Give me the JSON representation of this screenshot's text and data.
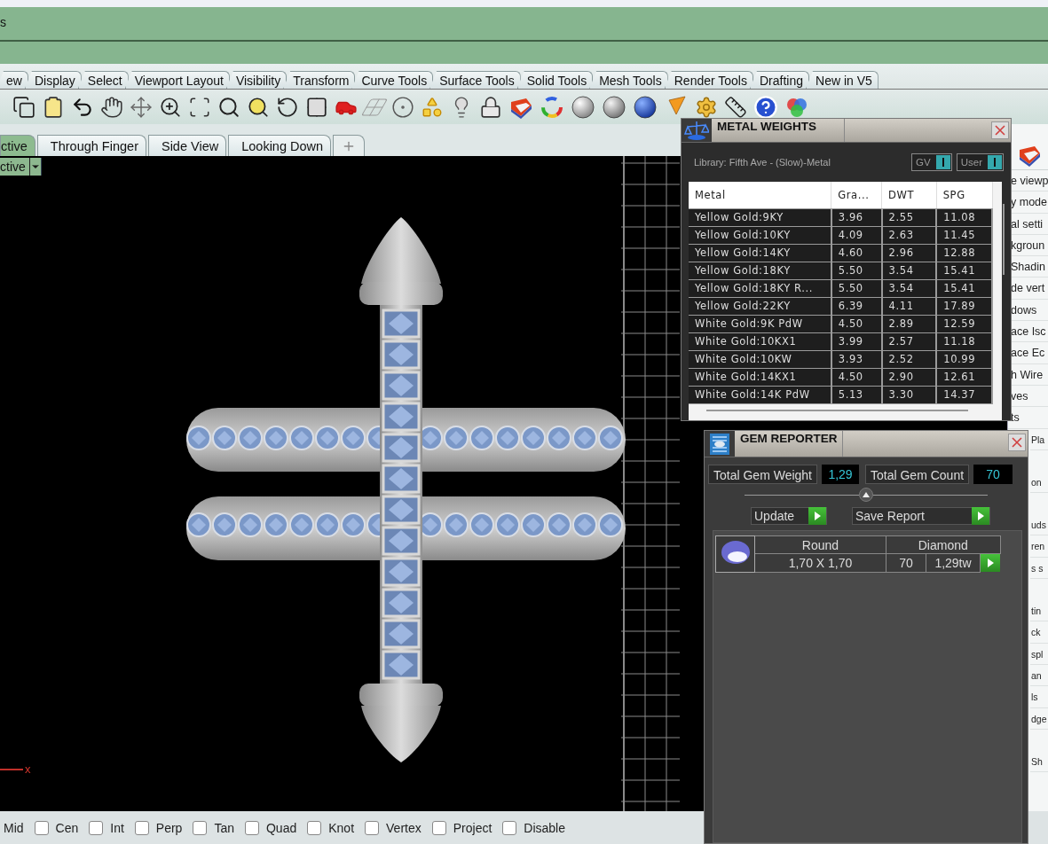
{
  "window": {
    "title": "s"
  },
  "toolbar_tabs": [
    {
      "label": "ew",
      "selected": false
    },
    {
      "label": "Display",
      "selected": false
    },
    {
      "label": "Select",
      "selected": false
    },
    {
      "label": "Viewport Layout",
      "selected": false
    },
    {
      "label": "Visibility",
      "selected": false
    },
    {
      "label": "Transform",
      "selected": false
    },
    {
      "label": "Curve Tools",
      "selected": false
    },
    {
      "label": "Surface Tools",
      "selected": false
    },
    {
      "label": "Solid Tools",
      "selected": false
    },
    {
      "label": "Mesh Tools",
      "selected": false
    },
    {
      "label": "Render Tools",
      "selected": false
    },
    {
      "label": "Drafting",
      "selected": false
    },
    {
      "label": "New in V5",
      "selected": false
    }
  ],
  "viewport_tabs": [
    {
      "label": "ctive",
      "selected": true
    },
    {
      "label": "Through Finger",
      "selected": false
    },
    {
      "label": "Side View",
      "selected": false
    },
    {
      "label": "Looking Down",
      "selected": false
    }
  ],
  "viewport": {
    "label": "ctive",
    "axis_label": "x"
  },
  "metal_weights": {
    "title": "METAL WEIGHTS",
    "library": "Library: Fifth Ave - (Slow)-Metal",
    "toggles": [
      {
        "label": "GV",
        "on": true
      },
      {
        "label": "User",
        "on": true
      }
    ],
    "columns": [
      "Metal",
      "Gra...",
      "DWT",
      "SPG"
    ],
    "rows": [
      [
        "Yellow Gold:9KY",
        "3.96",
        "2.55",
        "11.08"
      ],
      [
        "Yellow Gold:10KY",
        "4.09",
        "2.63",
        "11.45"
      ],
      [
        "Yellow Gold:14KY",
        "4.60",
        "2.96",
        "12.88"
      ],
      [
        "Yellow Gold:18KY",
        "5.50",
        "3.54",
        "15.41"
      ],
      [
        "Yellow Gold:18KY R...",
        "5.50",
        "3.54",
        "15.41"
      ],
      [
        "Yellow Gold:22KY",
        "6.39",
        "4.11",
        "17.89"
      ],
      [
        "White Gold:9K PdW",
        "4.50",
        "2.89",
        "12.59"
      ],
      [
        "White Gold:10KX1",
        "3.99",
        "2.57",
        "11.18"
      ],
      [
        "White Gold:10KW",
        "3.93",
        "2.52",
        "10.99"
      ],
      [
        "White Gold:14KX1",
        "4.50",
        "2.90",
        "12.61"
      ],
      [
        "White Gold:14K PdW",
        "5.13",
        "3.30",
        "14.37"
      ]
    ]
  },
  "gem_reporter": {
    "title": "GEM REPORTER",
    "total_weight_label": "Total Gem Weight",
    "total_weight": "1,29",
    "total_count_label": "Total Gem Count",
    "total_count": "70",
    "buttons": [
      "Update",
      "Save Report"
    ],
    "gems": [
      {
        "shape": "Round",
        "type": "Diamond",
        "size": "1,70 X 1,70",
        "count": "70",
        "weight": "1,29tw"
      }
    ]
  },
  "side_panel": {
    "items": [
      "e viewp",
      "y mode",
      "al setti",
      "kgroun",
      "Shadin",
      "de vert",
      "dows",
      "ace Isc",
      "ace Ec",
      "h Wire",
      "ves",
      "ts"
    ],
    "lower_groups": [
      [
        "Pla"
      ],
      [
        "on"
      ],
      [
        "uds",
        "ren",
        "s s"
      ],
      [
        "tin",
        "ck",
        "spl",
        "an",
        "ls",
        "dge"
      ],
      [
        "Sh"
      ]
    ]
  },
  "osnap_lead": "Mid",
  "osnaps": [
    {
      "label": "Cen",
      "checked": false
    },
    {
      "label": "Int",
      "checked": false
    },
    {
      "label": "Perp",
      "checked": false
    },
    {
      "label": "Tan",
      "checked": false
    },
    {
      "label": "Quad",
      "checked": false
    },
    {
      "label": "Knot",
      "checked": false
    },
    {
      "label": "Vertex",
      "checked": false
    },
    {
      "label": "Project",
      "checked": false
    },
    {
      "label": "Disable",
      "checked": false
    }
  ]
}
